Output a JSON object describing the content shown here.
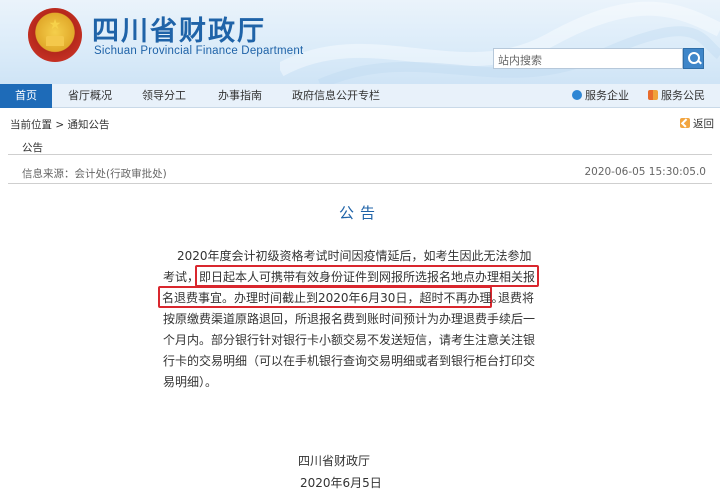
{
  "header": {
    "site_name": "四川省财政厅",
    "site_name_en": "Sichuan Provincial Finance Department",
    "search_placeholder": "站内搜索"
  },
  "nav": {
    "items": [
      "首页",
      "省厅概况",
      "领导分工",
      "办事指南",
      "政府信息公开专栏"
    ],
    "service_enterprise": "服务企业",
    "service_public": "服务公民"
  },
  "breadcrumb": {
    "current_label": "当前位置",
    "separator": ">",
    "current": "通知公告",
    "back": "返回"
  },
  "category": "公告",
  "meta": {
    "source": "信息来源：会计处(行政审批处)",
    "date": "2020-06-05 15:30:05.0"
  },
  "article": {
    "title": "公告",
    "lines": [
      "2020年度会计初级资格考试时间因疫情延后，如考生因此无法参加",
      "考试，",
      "即日起本人可携带有效身份证件到网报所选报名地点办理相关报",
      "名退费事宜。办理时间截止到2020年6月30日，超时不再办理。",
      "退费将",
      "按原缴费渠道原路退回，所退报名费到账时间预计为办理退费手续后一",
      "个月内。部分银行针对银行卡小额交易不发送短信，请考生注意关注银",
      "行卡的交易明细（可以在手机银行查询交易明细或者到银行柜台打印交",
      "易明细）。"
    ],
    "signature": "四川省财政厅",
    "sign_date": "2020年6月5日"
  },
  "colors": {
    "brand_blue": "#1f63a8",
    "nav_active": "#1e6bb8",
    "highlight_red": "#d9272e"
  }
}
